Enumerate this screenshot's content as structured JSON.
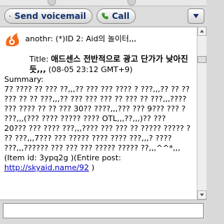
{
  "toolbar": {
    "voicemail_label": "Send voicemail",
    "call_label": "Call"
  },
  "message": {
    "sender": "anothr: (*)ID 2: Aid의 놀이터,,,",
    "title_prefix": "Title: ",
    "title": "애드센스 전반적으로 광고 단가가 낮아진듯,,,",
    "timestamp": " (08-05 23:12 GMT+9)",
    "summary_label": "Summary:",
    "summary_1": "7? ???? ?? ??? ??,,,?? ??? ??? ???? ? ???,,,?? ?? ?? ??? ?? ?? ???,,,?? ??? ??? ??? ?? ??? ?? ???,,,???? ??? ???? ?? ?? ??? 30?? ????,,,??? ??? 9??? ??? ? ???,,,(??? ???? ????? ???? OTL,,,??,,,)?? ???",
    "summary_2": "20??? ??? ???? ???,,,???? ??? ??? ?? ????? ????? ? ?? ???,,,7??? ??? ????? ???? ???? ???,,,? ???? ???,,,?????? ??? ??? ??? ????? ????? ??,,,^^*,,, (Item id: 3ypq2g )(Entire post:",
    "link": "http://skyaid.name/92",
    "close_paren": " )"
  },
  "input": {
    "value": ""
  }
}
